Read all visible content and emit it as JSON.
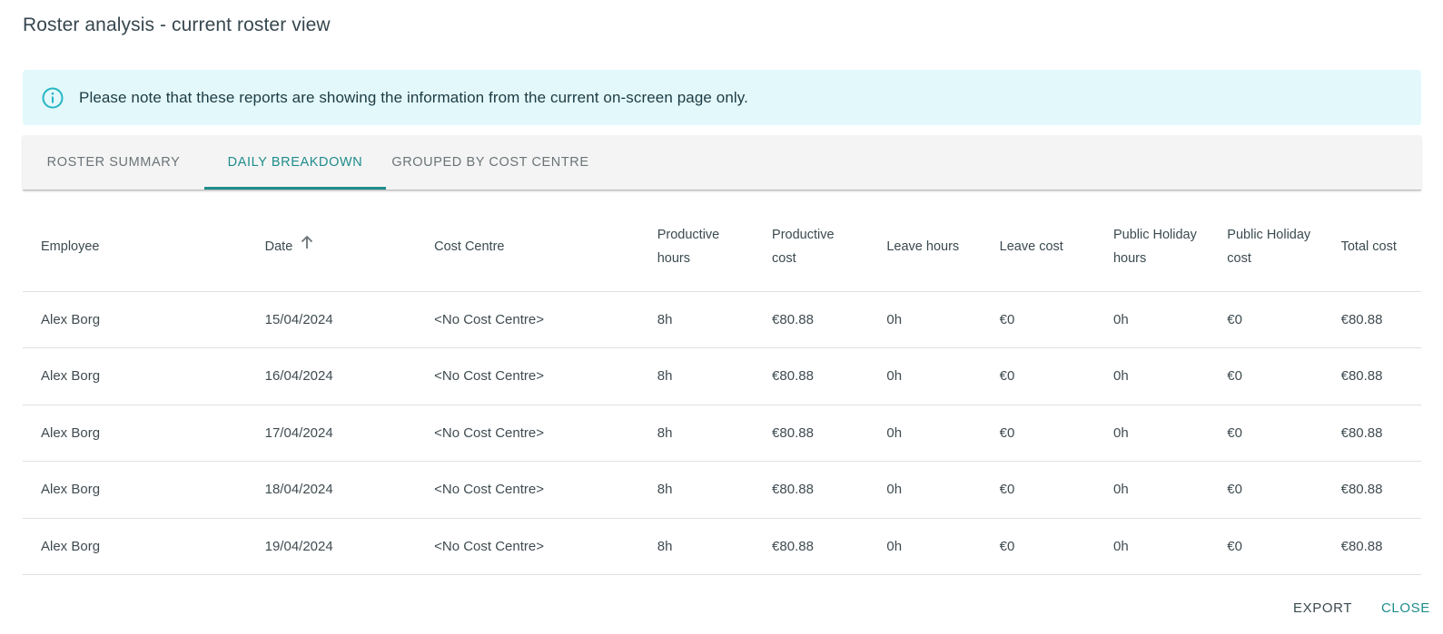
{
  "dialog": {
    "title": "Roster analysis - current roster view"
  },
  "info": {
    "text": "Please note that these reports are showing the information from the current on-screen page only."
  },
  "tabs": [
    {
      "label": "ROSTER SUMMARY"
    },
    {
      "label": "DAILY BREAKDOWN"
    },
    {
      "label": "GROUPED BY COST CENTRE"
    }
  ],
  "active_tab": "DAILY BREAKDOWN",
  "table": {
    "headers": [
      "Employee",
      "Date",
      "Cost Centre",
      "Productive hours",
      "Productive cost",
      "Leave hours",
      "Leave cost",
      "Public Holiday hours",
      "Public Holiday cost",
      "Total cost"
    ],
    "sort_column": "Date",
    "sort_direction": "ascending",
    "rows": [
      [
        "Alex Borg",
        "15/04/2024",
        "<No Cost Centre>",
        "8h",
        "€80.88",
        "0h",
        "€0",
        "0h",
        "€0",
        "€80.88"
      ],
      [
        "Alex Borg",
        "16/04/2024",
        "<No Cost Centre>",
        "8h",
        "€80.88",
        "0h",
        "€0",
        "0h",
        "€0",
        "€80.88"
      ],
      [
        "Alex Borg",
        "17/04/2024",
        "<No Cost Centre>",
        "8h",
        "€80.88",
        "0h",
        "€0",
        "0h",
        "€0",
        "€80.88"
      ],
      [
        "Alex Borg",
        "18/04/2024",
        "<No Cost Centre>",
        "8h",
        "€80.88",
        "0h",
        "€0",
        "0h",
        "€0",
        "€80.88"
      ],
      [
        "Alex Borg",
        "19/04/2024",
        "<No Cost Centre>",
        "8h",
        "€80.88",
        "0h",
        "€0",
        "0h",
        "€0",
        "€80.88"
      ]
    ]
  },
  "footer": {
    "export_label": "EXPORT",
    "close_label": "CLOSE"
  },
  "colors": {
    "accent": "#1f8c8c",
    "info_bg": "#e3f8fa",
    "info_icon": "#26b5c4",
    "tabs_bg": "#f4f4f4"
  },
  "icons": {
    "info": "info-circle-icon",
    "sort": "arrow-up-icon"
  }
}
